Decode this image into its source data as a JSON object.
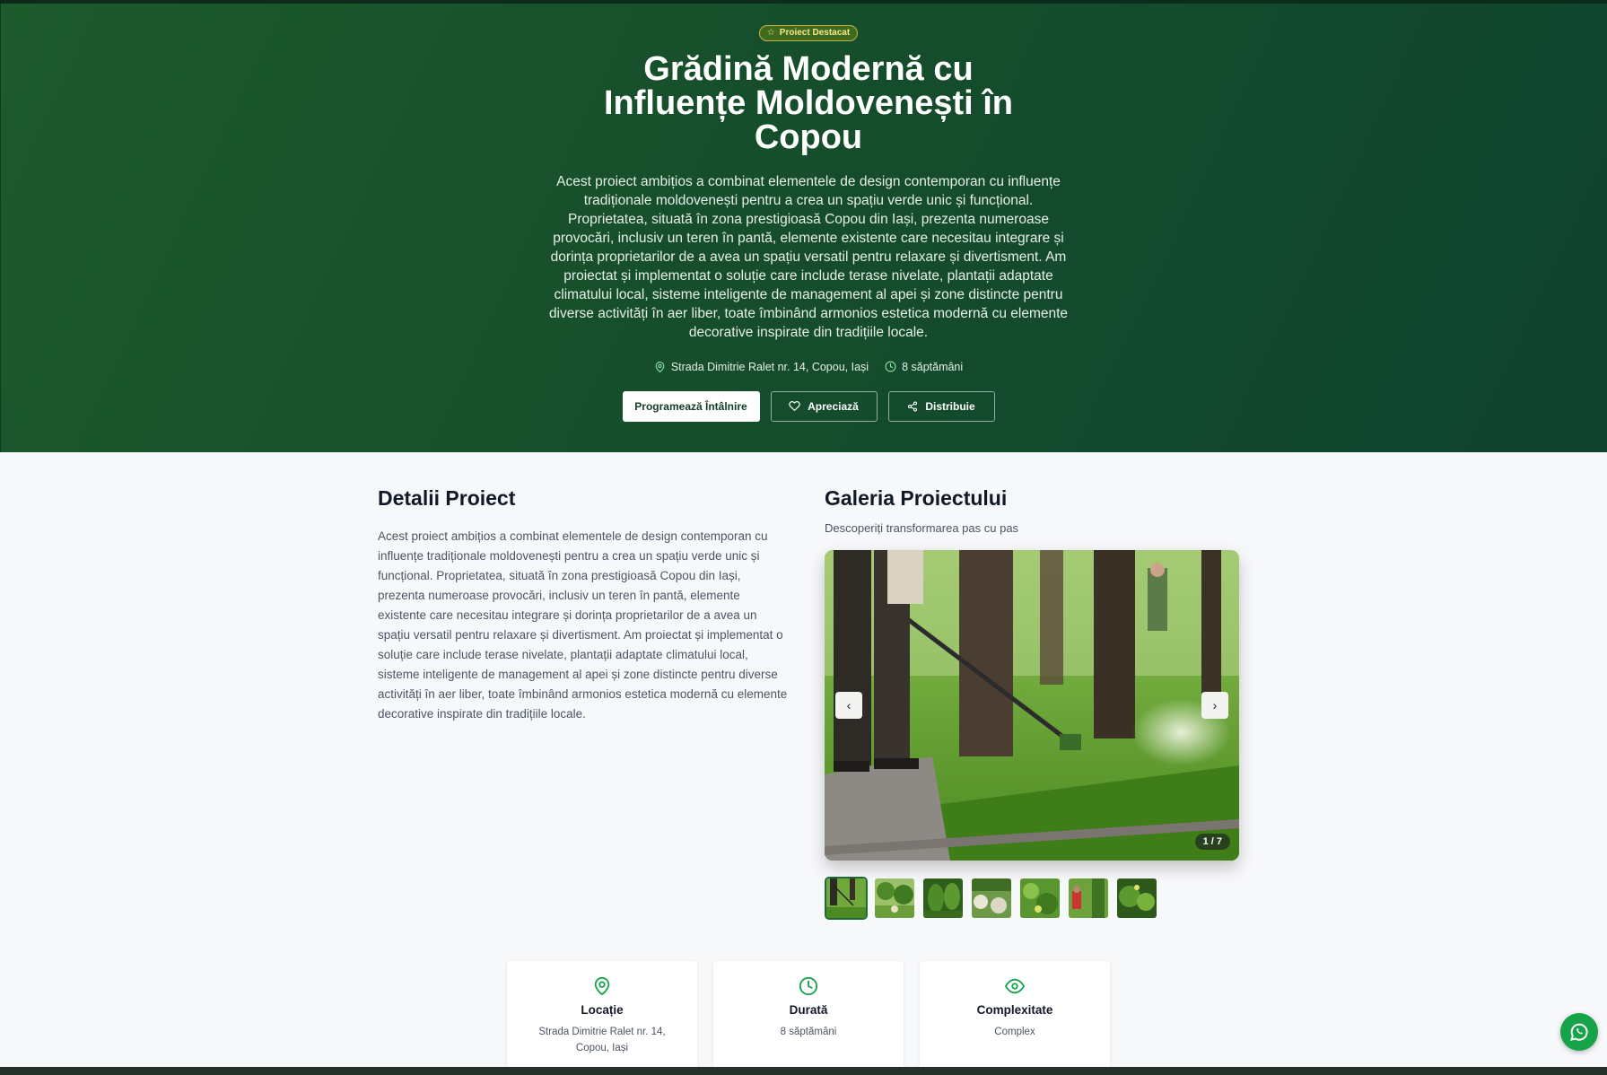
{
  "hero": {
    "badge": "Proiect Destacat",
    "title": "Grădină Modernă cu Influențe Moldovenești în Copou",
    "description": "Acest proiect ambițios a combinat elementele de design contemporan cu influențe tradiționale moldovenești pentru a crea un spațiu verde unic și funcțional. Proprietatea, situată în zona prestigioasă Copou din Iași, prezenta numeroase provocări, inclusiv un teren în pantă, elemente existente care necesitau integrare și dorința proprietarilor de a avea un spațiu versatil pentru relaxare și divertisment. Am proiectat și implementat o soluție care include terase nivelate, plantații adaptate climatului local, sisteme inteligente de management al apei și zone distincte pentru diverse activități în aer liber, toate îmbinând armonios estetica modernă cu elemente decorative inspirate din tradițiile locale.",
    "location": "Strada Dimitrie Ralet nr. 14, Copou, Iași",
    "duration": "8 săptămâni",
    "buttons": {
      "schedule": "Programează Întâlnire",
      "like": "Apreciază",
      "share": "Distribuie"
    }
  },
  "details": {
    "title": "Detalii Proiect",
    "text": "Acest proiect ambițios a combinat elementele de design contemporan cu influențe tradiționale moldovenești pentru a crea un spațiu verde unic și funcțional. Proprietatea, situată în zona prestigioasă Copou din Iași, prezenta numeroase provocări, inclusiv un teren în pantă, elemente existente care necesitau integrare și dorința proprietarilor de a avea un spațiu versatil pentru relaxare și divertisment. Am proiectat și implementat o soluție care include terase nivelate, plantații adaptate climatului local, sisteme inteligente de management al apei și zone distincte pentru diverse activități în aer liber, toate îmbinând armonios estetica modernă cu elemente decorative inspirate din tradițiile locale."
  },
  "gallery": {
    "title": "Galeria Proiectului",
    "subtitle": "Descoperiți transformarea pas cu pas",
    "prev": "‹",
    "next": "›",
    "counter": "1 / 7",
    "current_index": 1,
    "total_images": 7
  },
  "cards": [
    {
      "icon": "map-pin-icon",
      "title": "Locație",
      "value": "Strada Dimitrie Ralet nr. 14, Copou, Iași"
    },
    {
      "icon": "clock-icon",
      "title": "Durată",
      "value": "8 săptămâni"
    },
    {
      "icon": "eye-icon",
      "title": "Complexitate",
      "value": "Complex"
    }
  ],
  "colors": {
    "hero_bg": "#164e2b",
    "accent": "#16a34a",
    "badge_text": "#f5e58a"
  }
}
